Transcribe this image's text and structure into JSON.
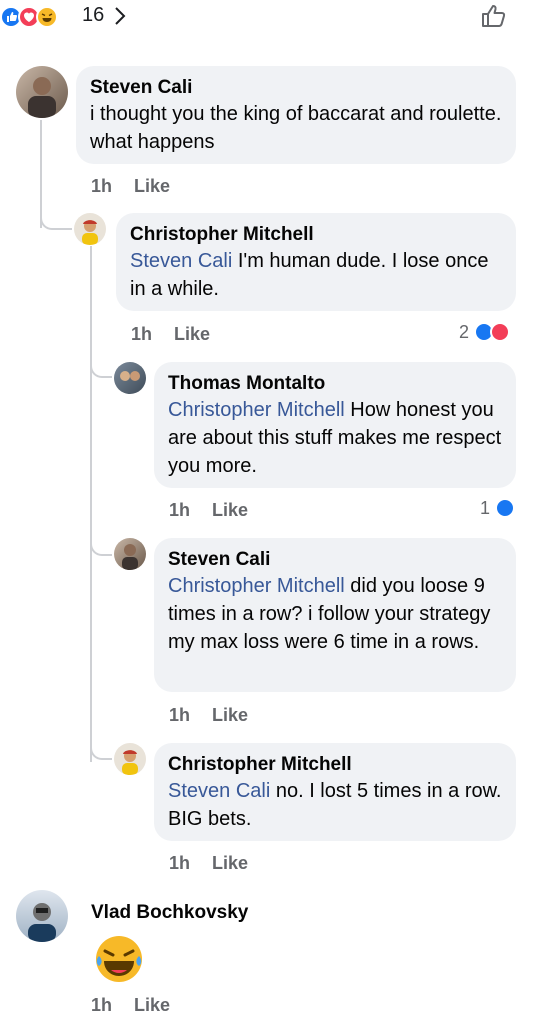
{
  "top_reactions": {
    "count": "16"
  },
  "comments": [
    {
      "name": "Steven Cali",
      "mention": "",
      "text": "i thought you the king of baccarat and roulette. what happens",
      "time": "1h",
      "like": "Like"
    },
    {
      "name": "Christopher Mitchell",
      "mention": "Steven Cali",
      "text": " I'm human dude. I lose once in a while.",
      "time": "1h",
      "like": "Like",
      "reaction_count": "2"
    },
    {
      "name": "Thomas Montalto",
      "mention": "Christopher Mitchell",
      "text": " How honest you are about this stuff makes me respect you more.",
      "time": "1h",
      "like": "Like",
      "reaction_count": "1"
    },
    {
      "name": "Steven Cali",
      "mention": "Christopher Mitchell",
      "text": " did you loose 9 times in a row?  i follow your strategy my max loss were 6 time in a rows.",
      "time": "1h",
      "like": "Like"
    },
    {
      "name": "Christopher Mitchell",
      "mention": "Steven Cali",
      "text": " no. I lost 5 times in a row. BIG bets.",
      "time": "1h",
      "like": "Like"
    },
    {
      "name": "Vlad Bochkovsky",
      "mention": "",
      "text": "",
      "time": "1h",
      "like": "Like"
    }
  ],
  "colors": {
    "like_blue": "#1877f2",
    "love_red": "#f33e58",
    "haha_yellow": "#f7b928",
    "mention": "#385898",
    "bubble": "#f0f2f5",
    "meta": "#65676b"
  }
}
